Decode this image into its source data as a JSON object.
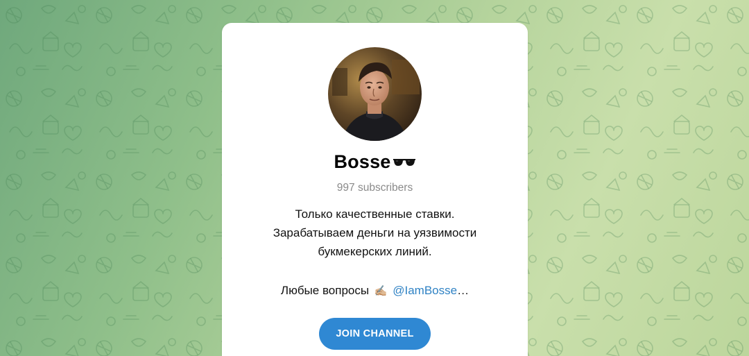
{
  "channel": {
    "name": "Bosse",
    "name_emoji_icon": "sunglasses-icon",
    "subscribers": "997 subscribers",
    "description_lines": [
      "Только качественные ставки.",
      "Зарабатываем деньги на уязвимости",
      "букмекерских линий."
    ],
    "question_prefix": "Любые вопросы",
    "question_emoji": "✍🏼",
    "mention": "@IamBosse",
    "mention_suffix": "…"
  },
  "actions": {
    "join_label": "JOIN CHANNEL"
  },
  "colors": {
    "background_start": "#6fa87c",
    "background_end": "#c9dfab",
    "card": "#ffffff",
    "accent": "#2f88d3",
    "mention": "#2f82c4",
    "muted_text": "#8a8a8a"
  }
}
